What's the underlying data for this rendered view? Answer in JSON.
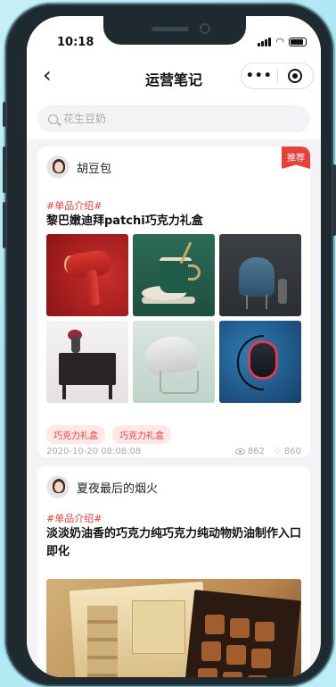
{
  "status_bar": {
    "time": "10:18"
  },
  "navbar": {
    "title": "运营笔记"
  },
  "search": {
    "placeholder": "花生豆奶"
  },
  "posts": [
    {
      "author": "胡豆包",
      "badge": "推荐",
      "topic": "#单品介绍#",
      "title": "黎巴嫩迪拜patchi巧克力礼盒",
      "tags": [
        "巧克力礼盒",
        "巧克力礼盒"
      ],
      "date": "2020-10-20 08:08:08",
      "views": "862",
      "likes": "860"
    },
    {
      "author": "夏夜最后的烟火",
      "topic": "#单品介绍#",
      "title": "淡淡奶油香的巧克力纯巧克力纯动物奶油制作入口即化"
    }
  ],
  "colors": {
    "accent": "#e8403a",
    "tag_bg": "#fde8e7",
    "page_bg": "#f3f3f5"
  }
}
